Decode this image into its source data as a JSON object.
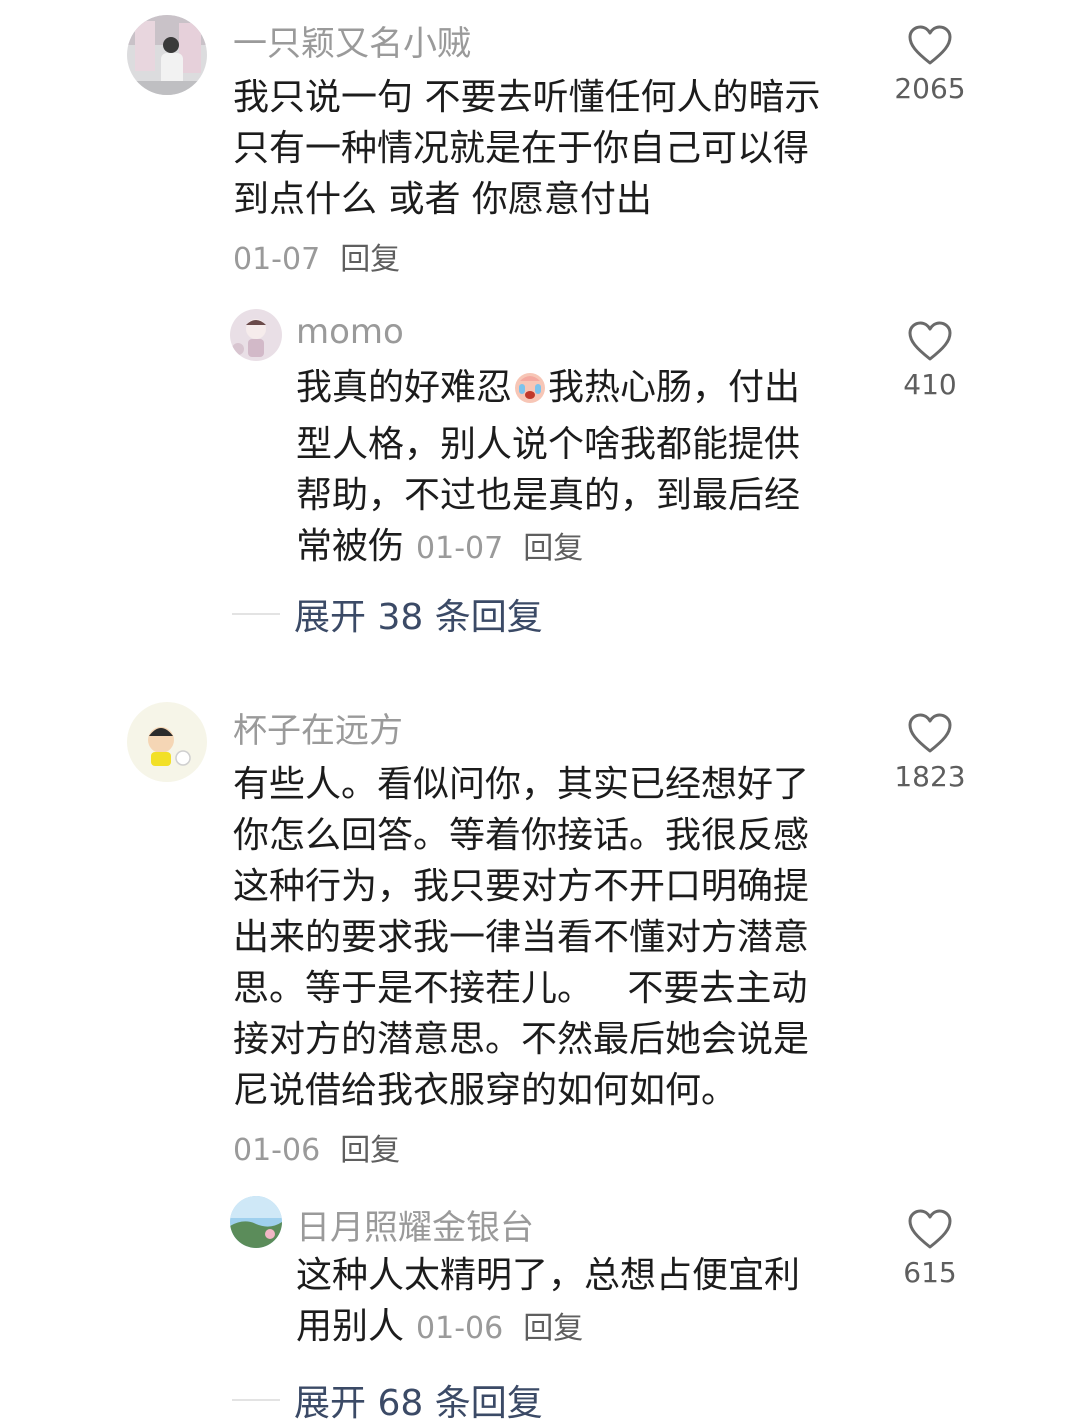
{
  "comments": [
    {
      "username": "一只颖又名小贼",
      "lines": [
        "我只说一句 不要去听懂任何人的暗示",
        "只有一种情况就是在于你自己可以得",
        "到点什么 或者 你愿意付出"
      ],
      "date": "01-07",
      "reply_label": "回复",
      "likes": "2065",
      "reply": {
        "username": "momo",
        "line1_before": "我真的好难忍",
        "emoji": "crying-face-emoji",
        "line1_after": "我热心肠，付出",
        "lines": [
          "型人格，别人说个啥我都能提供",
          "帮助，不过也是真的，到最后经"
        ],
        "last_line": "常被伤",
        "date": "01-07",
        "reply_label": "回复",
        "likes": "410"
      },
      "expand_label": "展开 38 条回复"
    },
    {
      "username": "杯子在远方",
      "lines": [
        "有些人。看似问你，其实已经想好了",
        "你怎么回答。等着你接话。我很反感",
        "这种行为，我只要对方不开口明确提",
        "出来的要求我一律当看不懂对方潜意",
        "思。等于是不接茬儿。   不要去主动",
        "接对方的潜意思。不然最后她会说是",
        "尼说借给我衣服穿的如何如何。"
      ],
      "date": "01-06",
      "reply_label": "回复",
      "likes": "1823",
      "reply": {
        "username": "日月照耀金银台",
        "lines": [
          "这种人太精明了，总想占便宜利"
        ],
        "last_line": "用别人",
        "date": "01-06",
        "reply_label": "回复",
        "likes": "615"
      },
      "expand_label": "展开 68 条回复"
    }
  ],
  "colors": {
    "username": "#9a9a9a",
    "text": "#1c1c1c",
    "link": "#3b4a66",
    "icon": "#6a6a6a"
  }
}
